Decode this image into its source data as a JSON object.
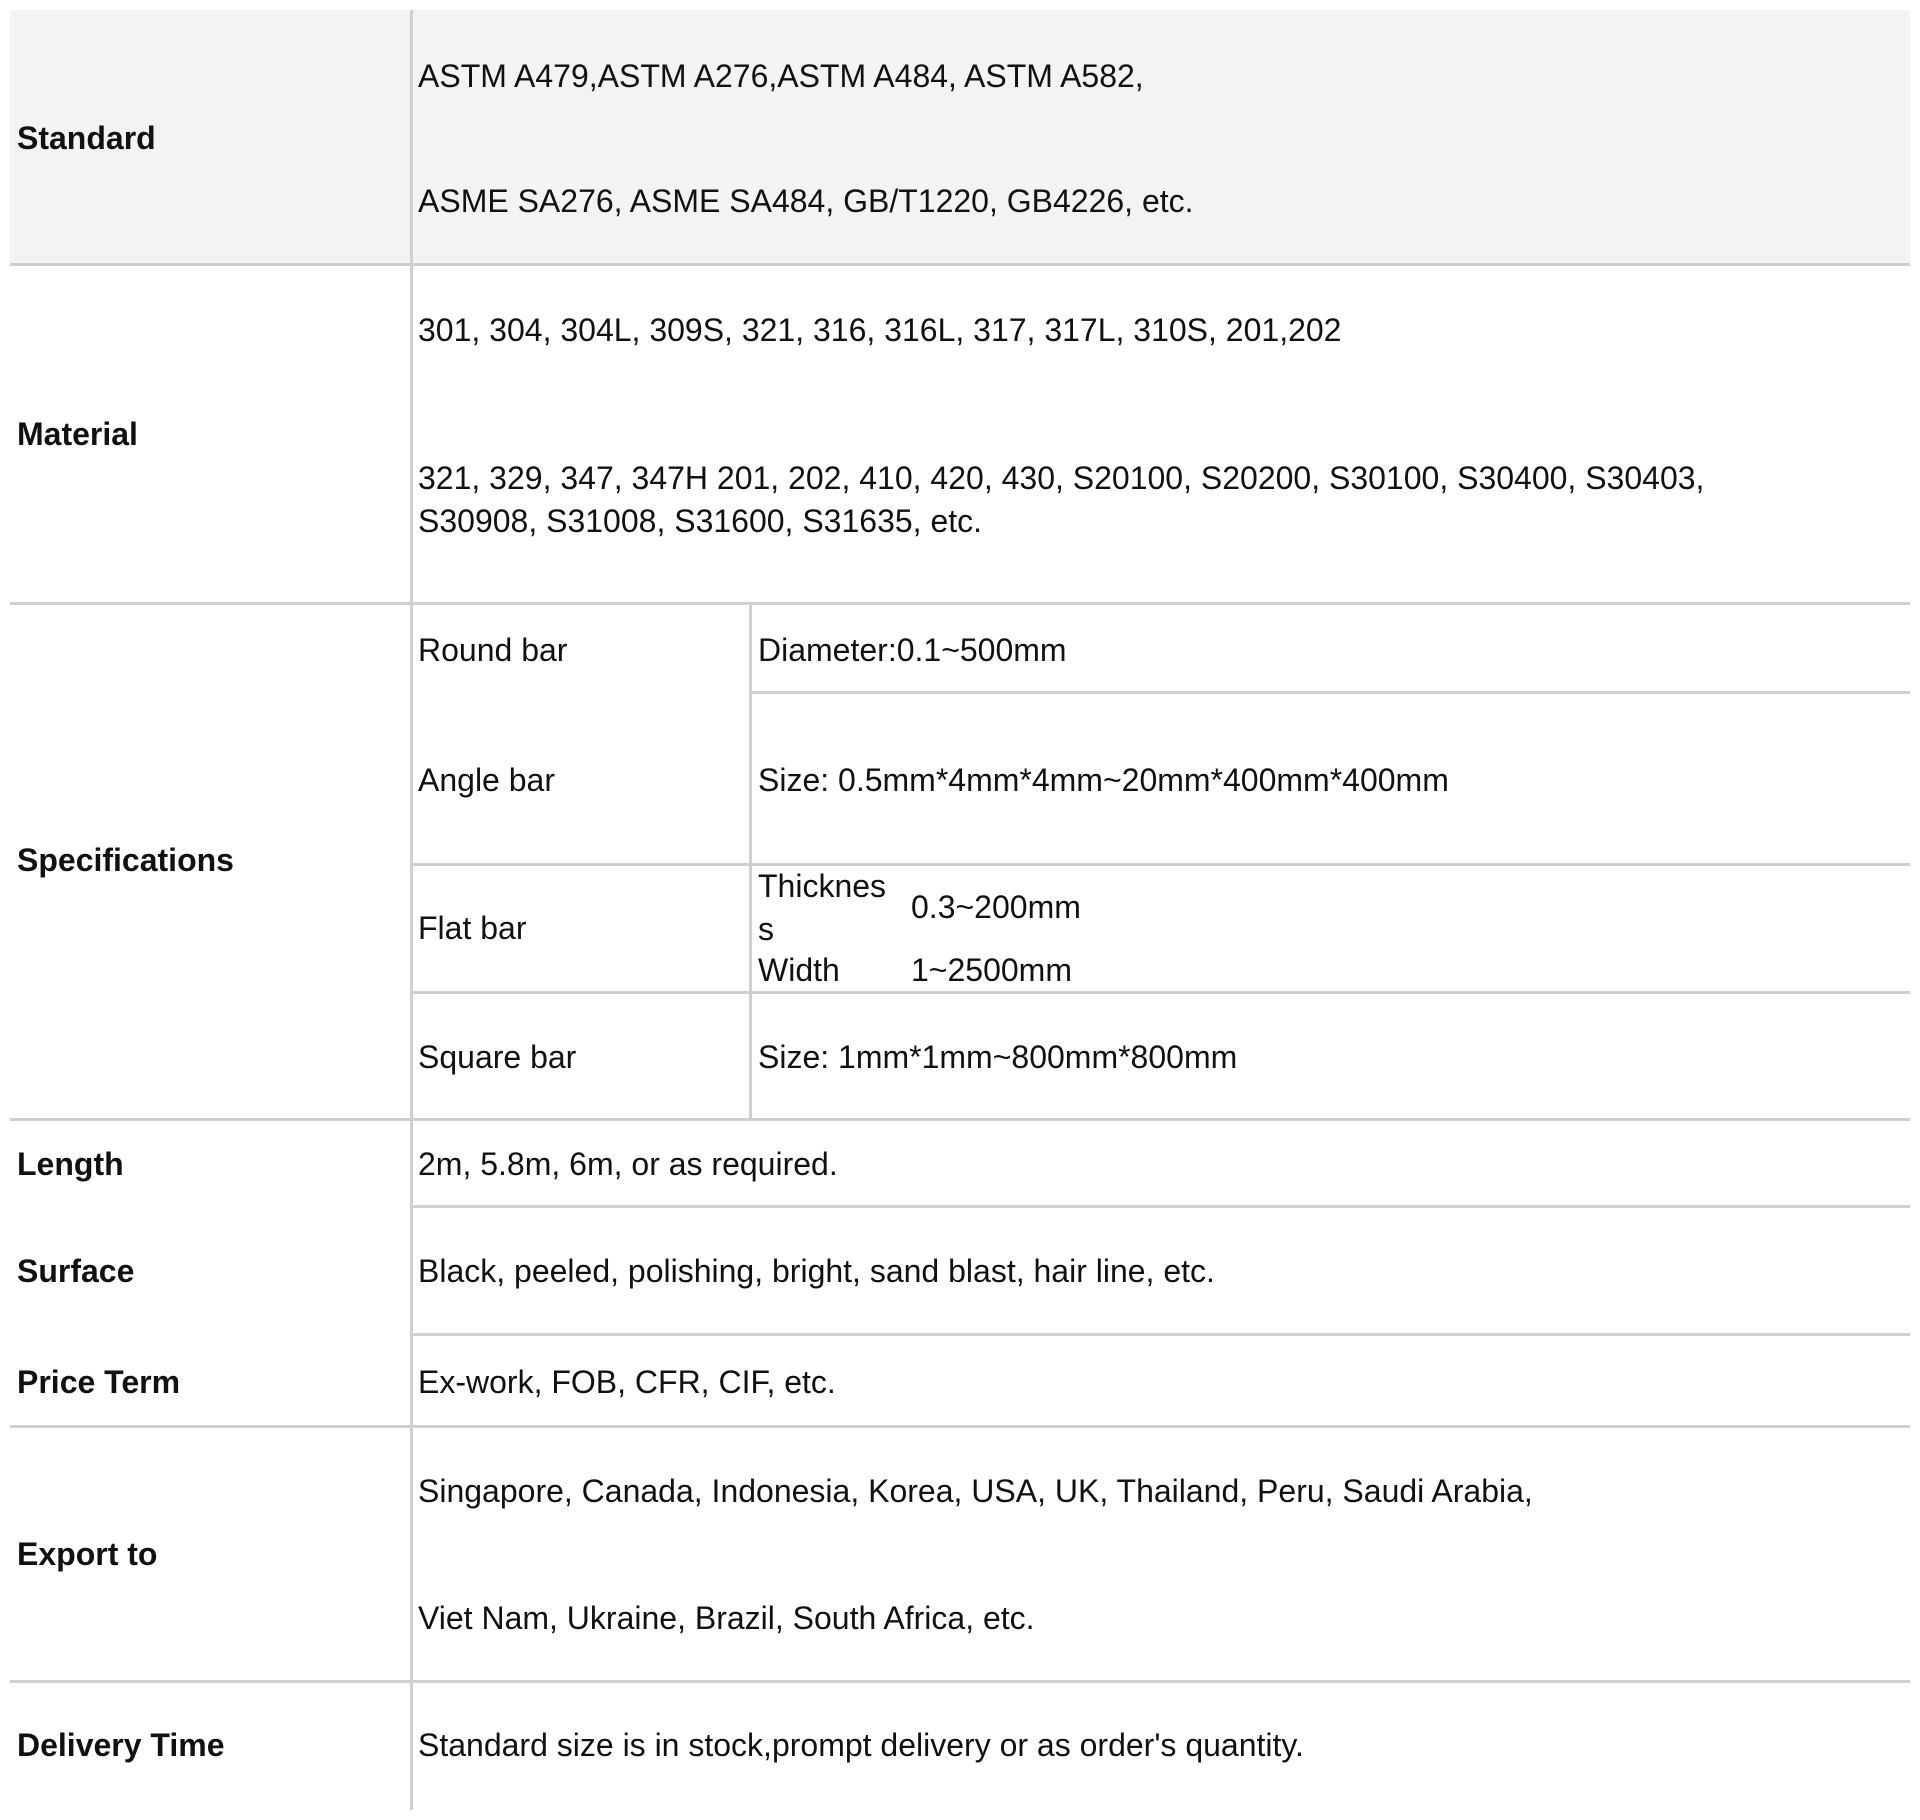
{
  "table": {
    "standard": {
      "label": "Standard",
      "line1": "ASTM A479,ASTM A276,ASTM A484, ASTM A582,",
      "line2": "ASME SA276, ASME SA484, GB/T1220, GB4226, etc."
    },
    "material": {
      "label": "Material",
      "line1": "301, 304, 304L, 309S, 321, 316, 316L, 317, 317L, 310S, 201,202",
      "line2": "321, 329, 347, 347H 201, 202, 410, 420, 430, S20100, S20200, S30100, S30400, S30403,",
      "line3": "S30908, S31008, S31600, S31635, etc."
    },
    "specifications": {
      "label": "Specifications",
      "round_bar": {
        "name": "Round bar",
        "value": "Diameter:0.1~500mm"
      },
      "angle_bar": {
        "name": "Angle bar",
        "value": "Size: 0.5mm*4mm*4mm~20mm*400mm*400mm"
      },
      "flat_bar": {
        "name": "Flat bar",
        "thickness_label_1": "Thicknes",
        "thickness_label_2": "s",
        "thickness_value": "0.3~200mm",
        "width_label": "Width",
        "width_value": "1~2500mm"
      },
      "square_bar": {
        "name": "Square bar",
        "value": "Size: 1mm*1mm~800mm*800mm"
      }
    },
    "length": {
      "label": "Length",
      "value": "2m, 5.8m, 6m, or as required."
    },
    "surface": {
      "label": "Surface",
      "value": "Black, peeled, polishing, bright, sand blast, hair line, etc."
    },
    "price_term": {
      "label": "Price Term",
      "value": "Ex-work, FOB, CFR, CIF, etc."
    },
    "export_to": {
      "label": "Export to",
      "line1": "Singapore, Canada, Indonesia, Korea, USA, UK, Thailand, Peru, Saudi Arabia,",
      "line2": "Viet Nam, Ukraine, Brazil, South Africa, etc."
    },
    "delivery_time": {
      "label": "Delivery Time",
      "value": "Standard size is in stock,prompt delivery or as order's quantity."
    }
  },
  "colors": {
    "header_band": "#f2f3f5",
    "grid_line": "#cfcfcf",
    "text": "#111111"
  }
}
